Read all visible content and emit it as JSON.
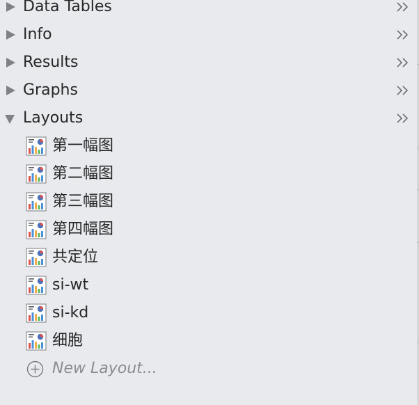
{
  "sections": [
    {
      "label": "Data Tables",
      "expanded": false,
      "icon": "triangle-right-icon"
    },
    {
      "label": "Info",
      "expanded": false,
      "icon": "triangle-right-icon"
    },
    {
      "label": "Results",
      "expanded": false,
      "icon": "triangle-right-icon"
    },
    {
      "label": "Graphs",
      "expanded": false,
      "icon": "triangle-right-icon"
    },
    {
      "label": "Layouts",
      "expanded": true,
      "icon": "triangle-down-icon"
    }
  ],
  "layouts": {
    "items": [
      {
        "label": "第一幅图",
        "icon": "layout-sheet-icon"
      },
      {
        "label": "第二幅图",
        "icon": "layout-sheet-icon"
      },
      {
        "label": "第三幅图",
        "icon": "layout-sheet-icon"
      },
      {
        "label": "第四幅图",
        "icon": "layout-sheet-icon"
      },
      {
        "label": "共定位",
        "icon": "layout-sheet-icon"
      },
      {
        "label": "si-wt",
        "icon": "layout-sheet-icon"
      },
      {
        "label": "si-kd",
        "icon": "layout-sheet-icon"
      },
      {
        "label": "细胞",
        "icon": "layout-sheet-icon"
      }
    ],
    "new_label": "New Layout...",
    "new_icon": "circle-plus-icon"
  },
  "colors": {
    "background": "#e8eaee",
    "text": "#262626",
    "muted": "#8a8c91",
    "triangle": "#7f8186"
  }
}
